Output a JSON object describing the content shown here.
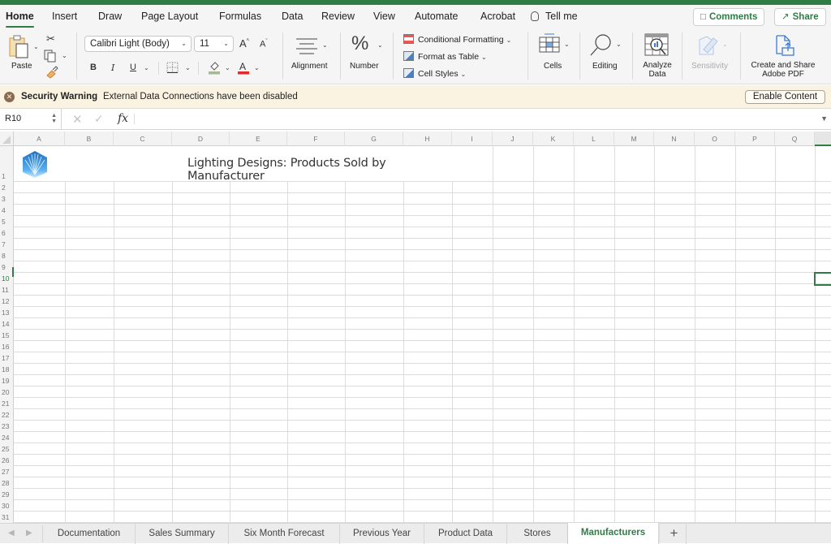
{
  "app": {
    "accent_color": "#2f7d45"
  },
  "menu_tabs": [
    {
      "label": "Home",
      "active": true
    },
    {
      "label": "Insert"
    },
    {
      "label": "Draw"
    },
    {
      "label": "Page Layout"
    },
    {
      "label": "Formulas"
    },
    {
      "label": "Data"
    },
    {
      "label": "Review"
    },
    {
      "label": "View"
    },
    {
      "label": "Automate"
    },
    {
      "label": "Acrobat"
    }
  ],
  "tell_me": "Tell me",
  "top_buttons": {
    "comments": "Comments",
    "share": "Share"
  },
  "ribbon": {
    "paste": "Paste",
    "font_name": "Calibri Light (Body)",
    "font_size": "11",
    "grow_font": "A",
    "shrink_font": "A",
    "bold": "B",
    "italic": "I",
    "underline": "U",
    "alignment": "Alignment",
    "number": "Number",
    "conditional_formatting": "Conditional Formatting",
    "format_as_table": "Format as Table",
    "cell_styles": "Cell Styles",
    "cells": "Cells",
    "editing": "Editing",
    "analyze_data_line1": "Analyze",
    "analyze_data_line2": "Data",
    "sensitivity": "Sensitivity",
    "adobe_line1": "Create and Share",
    "adobe_line2": "Adobe PDF"
  },
  "security_bar": {
    "title": "Security Warning",
    "message": "External Data Connections have been disabled",
    "button": "Enable Content"
  },
  "formula_bar": {
    "name_box": "R10",
    "fx": "fx",
    "formula": ""
  },
  "grid": {
    "columns": [
      "A",
      "B",
      "C",
      "D",
      "E",
      "F",
      "G",
      "H",
      "I",
      "J",
      "K",
      "L",
      "M",
      "N",
      "O",
      "P",
      "Q"
    ],
    "rows": [
      "1",
      "2",
      "3",
      "4",
      "5",
      "6",
      "7",
      "8",
      "9",
      "10",
      "11",
      "12",
      "13",
      "14",
      "15",
      "16",
      "17",
      "18",
      "19",
      "20",
      "21",
      "22",
      "23",
      "24",
      "25",
      "26",
      "27",
      "28",
      "29",
      "30",
      "31"
    ],
    "selected_cell": "R10",
    "title": "Lighting Designs: Products Sold by Manufacturer"
  },
  "sheet_tabs": [
    {
      "label": "Documentation"
    },
    {
      "label": "Sales Summary"
    },
    {
      "label": "Six Month Forecast"
    },
    {
      "label": "Previous Year"
    },
    {
      "label": "Product Data"
    },
    {
      "label": "Stores"
    },
    {
      "label": "Manufacturers",
      "active": true
    }
  ],
  "add_sheet": "+"
}
